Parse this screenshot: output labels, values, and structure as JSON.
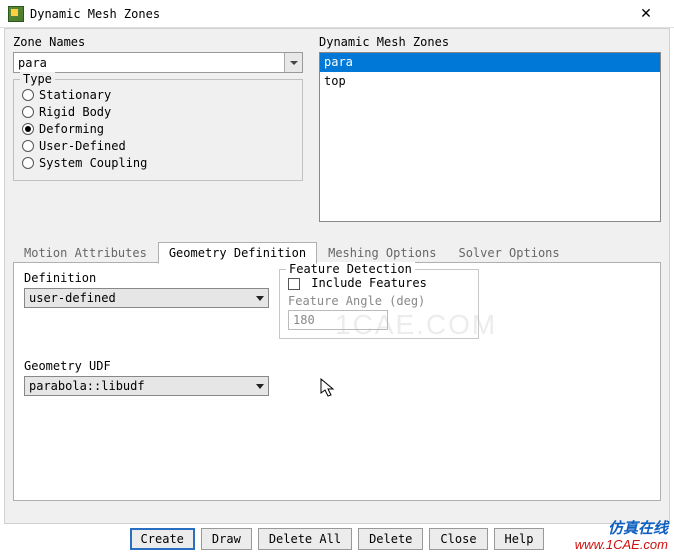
{
  "window": {
    "title": "Dynamic Mesh Zones"
  },
  "zone_names": {
    "label": "Zone Names",
    "value": "para"
  },
  "type_group": {
    "legend": "Type",
    "options": {
      "stationary": "Stationary",
      "rigid_body": "Rigid Body",
      "deforming": "Deforming",
      "user_defined": "User-Defined",
      "system_coupling": "System Coupling"
    },
    "selected": "deforming"
  },
  "zones_list": {
    "label": "Dynamic Mesh Zones",
    "items": [
      "para",
      "top"
    ],
    "selected": "para"
  },
  "tabs": {
    "motion": "Motion Attributes",
    "geometry": "Geometry Definition",
    "meshing": "Meshing Options",
    "solver": "Solver Options"
  },
  "definition": {
    "label": "Definition",
    "value": "user-defined"
  },
  "feature": {
    "legend": "Feature Detection",
    "include_label": "Include Features",
    "angle_label": "Feature Angle (deg)",
    "angle_value": "180"
  },
  "geom_udf": {
    "label": "Geometry UDF",
    "value": "parabola::libudf"
  },
  "buttons": {
    "create": "Create",
    "draw": "Draw",
    "delete_all": "Delete All",
    "delete": "Delete",
    "close": "Close",
    "help": "Help"
  },
  "watermark": {
    "cn": "仿真在线",
    "url": "www.1CAE.com"
  },
  "faint_watermark": "1CAE.COM"
}
